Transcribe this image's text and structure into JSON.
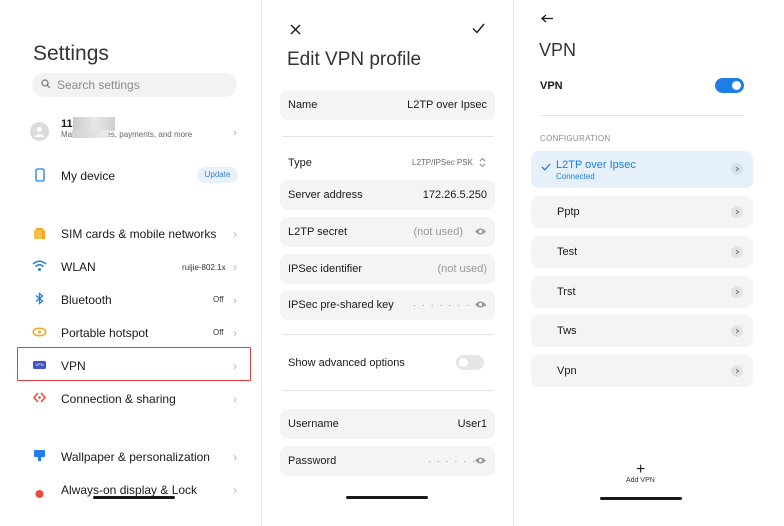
{
  "settings": {
    "title": "Settings",
    "search_placeholder": "Search settings",
    "account": {
      "id_prefix": "11",
      "description": "Ma           ud services, payments, and more"
    },
    "my_device": {
      "label": "My device",
      "update_label": "Update"
    },
    "items": [
      {
        "label": "SIM cards & mobile networks",
        "value": ""
      },
      {
        "label": "WLAN",
        "value": "ruijie-802.1x"
      },
      {
        "label": "Bluetooth",
        "value": "Off"
      },
      {
        "label": "Portable hotspot",
        "value": "Off"
      },
      {
        "label": "VPN",
        "value": ""
      },
      {
        "label": "Connection & sharing",
        "value": ""
      },
      {
        "label": "Wallpaper & personalization",
        "value": ""
      },
      {
        "label": "Always-on display & Lock",
        "value": ""
      }
    ],
    "vpn_icon_text": "VPN"
  },
  "edit_profile": {
    "title": "Edit VPN profile",
    "name": {
      "label": "Name",
      "value": "L2TP over Ipsec"
    },
    "type": {
      "label": "Type",
      "value": "L2TP/IPSec PSK"
    },
    "server": {
      "label": "Server address",
      "value": "172.26.5.250"
    },
    "l2tp_secret": {
      "label": "L2TP secret",
      "value": "(not used)"
    },
    "ipsec_id": {
      "label": "IPSec identifier",
      "value": "(not used)"
    },
    "ipsec_psk": {
      "label": "IPSec pre-shared key",
      "value": "· · · · · · · · ·"
    },
    "advanced": {
      "label": "Show advanced options",
      "enabled": false
    },
    "username": {
      "label": "Username",
      "value": "User1"
    },
    "password": {
      "label": "Password",
      "value": "· · · · · · ·"
    }
  },
  "vpn": {
    "title": "VPN",
    "toggle_label": "VPN",
    "toggle_on": true,
    "config_header": "CONFIGURATION",
    "profiles": [
      {
        "name": "L2TP over Ipsec",
        "status": "Connected"
      },
      {
        "name": "Pptp"
      },
      {
        "name": "Test"
      },
      {
        "name": "Trst"
      },
      {
        "name": "Tws"
      },
      {
        "name": "Vpn"
      }
    ],
    "add_label": "Add VPN"
  },
  "colors": {
    "accent": "#1e7ee6",
    "highlight": "#e23b3b"
  }
}
